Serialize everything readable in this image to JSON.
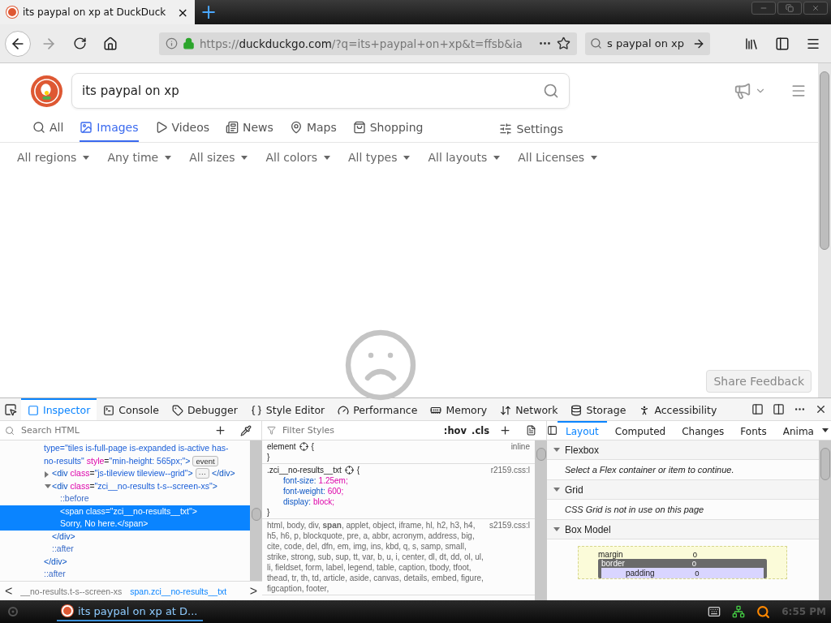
{
  "browser": {
    "tab": {
      "title": "its paypal on xp at DuckDuck",
      "close": "×"
    },
    "new_tab": "+",
    "url": {
      "scheme": "https://",
      "host": "duckduckgo.com",
      "path": "/?q=its+paypal+on+xp&t=ffsb&ia"
    },
    "search": {
      "value": "s paypal on xp"
    }
  },
  "page": {
    "search": {
      "value": "its paypal on xp"
    },
    "tabs": [
      {
        "label": "All",
        "selected": false
      },
      {
        "label": "Images",
        "selected": true
      },
      {
        "label": "Videos",
        "selected": false
      },
      {
        "label": "News",
        "selected": false
      },
      {
        "label": "Maps",
        "selected": false
      },
      {
        "label": "Shopping",
        "selected": false
      }
    ],
    "settings": "Settings",
    "filters": [
      "All regions",
      "Any time",
      "All sizes",
      "All colors",
      "All types",
      "All layouts",
      "All Licenses"
    ],
    "feedback": "Share Feedback"
  },
  "devtools": {
    "tools": [
      {
        "label": "Inspector",
        "selected": true
      },
      {
        "label": "Console",
        "selected": false
      },
      {
        "label": "Debugger",
        "selected": false
      },
      {
        "label": "Style Editor",
        "selected": false
      },
      {
        "label": "Performance",
        "selected": false
      },
      {
        "label": "Memory",
        "selected": false
      },
      {
        "label": "Network",
        "selected": false
      },
      {
        "label": "Storage",
        "selected": false
      },
      {
        "label": "Accessibility",
        "selected": false
      }
    ],
    "markup": {
      "placeholder": "Search HTML",
      "tree": [
        {
          "selected": false,
          "lines": [
            [
              {
                "kind": "val",
                "t": "type=\"tiles is-full-page is-expanded is-active has-"
              }
            ],
            [
              {
                "kind": "val",
                "t": "no-results\""
              },
              {
                "kind": "attr",
                "t": " style"
              },
              {
                "kind": "plain",
                "t": "="
              },
              {
                "kind": "val",
                "t": "\"min-height: 565px;\""
              },
              {
                "kind": "tag",
                "t": ">"
              },
              {
                "kind": "badge",
                "t": "event"
              }
            ]
          ],
          "close": [
            {
              "kind": "tag",
              "t": "</div>"
            }
          ],
          "children": [
            {
              "selected": false,
              "expanded": false,
              "lines": [
                [
                  {
                    "kind": "tag",
                    "t": "<div "
                  },
                  {
                    "kind": "attr",
                    "t": "class"
                  },
                  {
                    "kind": "plain",
                    "t": "="
                  },
                  {
                    "kind": "val",
                    "t": "\"js-tileview tileview--grid\""
                  },
                  {
                    "kind": "tag",
                    "t": ">"
                  },
                  {
                    "kind": "badge",
                    "t": "···"
                  },
                  {
                    "kind": "tag",
                    "t": "</div>"
                  }
                ]
              ]
            },
            {
              "selected": false,
              "expanded": true,
              "lines": [
                [
                  {
                    "kind": "tag",
                    "t": "<div "
                  },
                  {
                    "kind": "attr",
                    "t": "class"
                  },
                  {
                    "kind": "plain",
                    "t": "="
                  },
                  {
                    "kind": "val",
                    "t": "\"zci__no-results t-s--screen-xs\""
                  },
                  {
                    "kind": "tag",
                    "t": ">"
                  }
                ]
              ],
              "close": [
                {
                  "kind": "tag",
                  "t": "</div>"
                }
              ],
              "children": [
                {
                  "selected": false,
                  "lines": [
                    [
                      {
                        "kind": "pseudo",
                        "t": "::before"
                      }
                    ]
                  ]
                },
                {
                  "selected": true,
                  "lines": [
                    [
                      {
                        "kind": "tag",
                        "t": "<span class=\"zci__no-results__txt\">"
                      }
                    ],
                    [
                      {
                        "kind": "plain",
                        "t": "Sorry, No here."
                      },
                      {
                        "kind": "tag",
                        "t": "</span>"
                      }
                    ]
                  ]
                }
              ]
            },
            {
              "selected": false,
              "lines": [
                [
                  {
                    "kind": "pseudo",
                    "t": "::after"
                  }
                ]
              ]
            }
          ]
        },
        {
          "selected": false,
          "lines": [
            [
              {
                "kind": "pseudo",
                "t": "::after"
              }
            ]
          ]
        }
      ],
      "breadcrumbs": [
        {
          "label": "__no-results.t-s--screen-xs",
          "selected": false
        },
        {
          "label": "span.zci__no-results__txt",
          "selected": true
        }
      ],
      "prev": "<",
      "next": ">"
    },
    "rules": {
      "placeholder": "Filter Styles",
      "hov": ":hov",
      "cls": ".cls",
      "list": [
        {
          "selector": "element",
          "source": "inline",
          "gear": true,
          "open": "{",
          "close": "}"
        },
        {
          "selector": ".zci__no-results__txt",
          "source": "r2159.css:l",
          "gear": true,
          "open": "{",
          "close": "}",
          "declarations": [
            {
              "property": "font-size:",
              "value": "1.25em;"
            },
            {
              "property": "font-weight:",
              "value": "600;"
            },
            {
              "property": "display:",
              "value": "block;"
            }
          ]
        },
        {
          "selector": "html, body, div, **span**, applet, object, iframe, hl, h2, h3, h4, h5, h6, p, blockquote, pre, a, abbr, acronym, address, big, cite, code, del, dfn, em, img, ins, kbd, q, s, samp, small, strike, strong, sub, sup, tt, var, b, u, i, center, dl, dt, dd, ol, ul, li, fieldset, form, label, legend, table, caption, tbody, tfoot, thead, tr, th, td, article, aside, canvas, details, embed, figure, figcaption, footer,",
          "source": "s2159.css:l",
          "gear": false
        }
      ]
    },
    "sidebar": {
      "tabs": [
        {
          "label": "Layout",
          "selected": true
        },
        {
          "label": "Computed",
          "selected": false
        },
        {
          "label": "Changes",
          "selected": false
        },
        {
          "label": "Fonts",
          "selected": false
        },
        {
          "label": "Anima",
          "selected": false
        }
      ],
      "sections": [
        {
          "kind": "message",
          "title": "Flexbox",
          "expanded": true,
          "text": "Select a Flex container or item to continue."
        },
        {
          "kind": "message",
          "title": "Grid",
          "expanded": true,
          "text": "CSS Grid is not in use on this page"
        },
        {
          "kind": "boxmodel",
          "title": "Box Model",
          "expanded": true,
          "margin": {
            "label": "margin",
            "value": "0"
          },
          "border": {
            "label": "border",
            "value": "0"
          },
          "padding": {
            "label": "padding",
            "value": "0"
          }
        }
      ]
    }
  },
  "taskbar": {
    "task": {
      "label": "its paypal on xp at D...",
      "selected": true
    },
    "clock": "6:55 PM"
  }
}
